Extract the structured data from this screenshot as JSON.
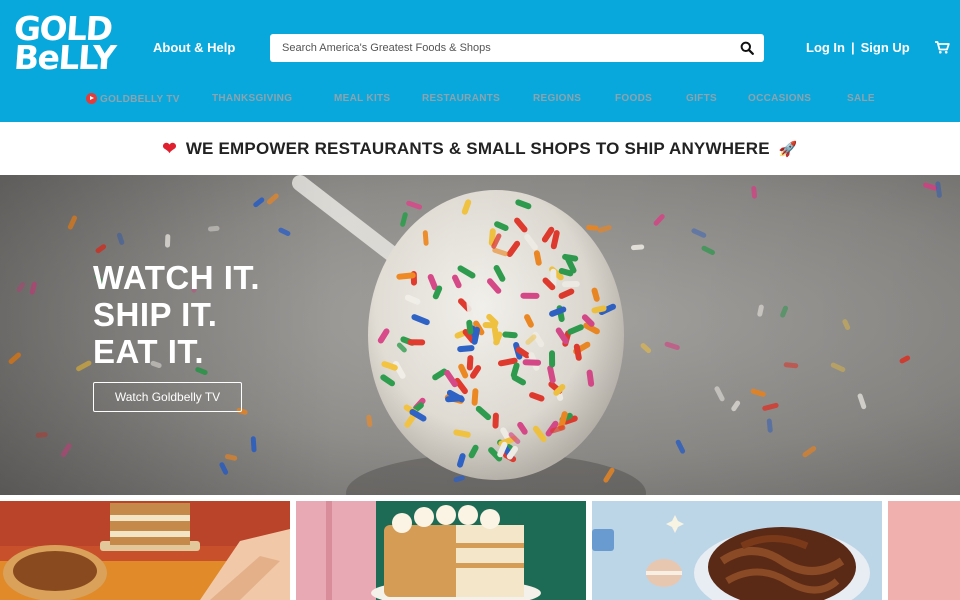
{
  "header": {
    "logo_line1": "GOLD",
    "logo_line2": "BeLLY",
    "about_label": "About & Help",
    "search_placeholder": "Search America's Greatest Foods & Shops",
    "login_label": "Log In",
    "login_separator": "|",
    "signup_label": "Sign Up",
    "icons": {
      "search": "search-icon",
      "cart": "cart-icon"
    },
    "brand_color": "#09a8dc"
  },
  "nav": {
    "items": [
      {
        "label": "GOLDBELLY TV"
      },
      {
        "label": "THANKSGIVING"
      },
      {
        "label": "MEAL KITS"
      },
      {
        "label": "RESTAURANTS"
      },
      {
        "label": "REGIONS"
      },
      {
        "label": "FOODS"
      },
      {
        "label": "GIFTS"
      },
      {
        "label": "OCCASIONS"
      },
      {
        "label": "SALE"
      }
    ]
  },
  "banner": {
    "text": "WE EMPOWER RESTAURANTS & SMALL SHOPS TO SHIP ANYWHERE",
    "left_emoji": "❤",
    "right_emoji": "🚀"
  },
  "hero": {
    "lines": [
      "WATCH IT.",
      "SHIP IT.",
      "EAT IT."
    ],
    "button_label": "Watch Goldbelly TV"
  }
}
